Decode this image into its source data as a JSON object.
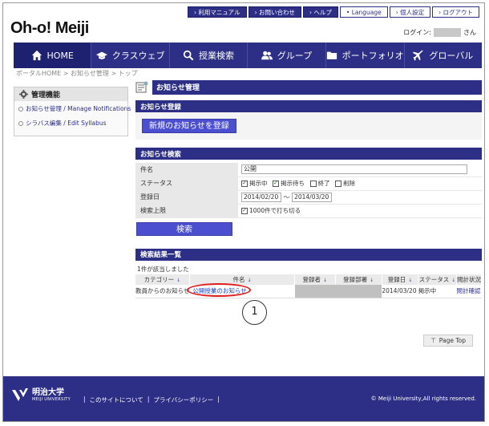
{
  "header": {
    "logo": "Oh-o! Meiji",
    "util_links": [
      {
        "label": "› 利用マニュアル"
      },
      {
        "label": "› お問い合わせ"
      },
      {
        "label": "› ヘルプ"
      },
      {
        "label": "• Language"
      },
      {
        "label": "› 個人設定"
      },
      {
        "label": "› ログアウト"
      }
    ],
    "login_label": "ログイン:",
    "login_suffix": "さん"
  },
  "nav": [
    {
      "label": "HOME",
      "icon": "home-icon"
    },
    {
      "label": "クラスウェブ",
      "icon": "mortarboard-icon"
    },
    {
      "label": "授業検索",
      "icon": "search-icon"
    },
    {
      "label": "グループ",
      "icon": "people-icon"
    },
    {
      "label": "ポートフォリオ",
      "icon": "folder-icon"
    },
    {
      "label": "グローバル",
      "icon": "airplane-icon"
    }
  ],
  "breadcrumb": "ポータルHOME > お知らせ管理 > トップ",
  "sidebar": {
    "title": "管理機能",
    "items": [
      {
        "label": "お知らせ管理 / Manage Notifications"
      },
      {
        "label": "シラバス編集 / Edit Syllabus"
      }
    ]
  },
  "main": {
    "page_title": "お知らせ管理",
    "register": {
      "heading": "お知らせ登録",
      "button": "新規のお知らせを登録"
    },
    "search": {
      "heading": "お知らせ検索",
      "name_label": "件名",
      "name_value": "公開",
      "status_label": "ステータス",
      "status_options": [
        {
          "label": "掲示中",
          "checked": true
        },
        {
          "label": "掲示待ち",
          "checked": true
        },
        {
          "label": "終了",
          "checked": false
        },
        {
          "label": "削除",
          "checked": false
        }
      ],
      "date_label": "登録日",
      "date_from": "2014/02/20",
      "date_sep": "～",
      "date_to": "2014/03/20",
      "limit_label": "検索上限",
      "limit_option": "1000件で打ち切る",
      "button": "検索"
    },
    "results": {
      "heading": "検索結果一覧",
      "count_text": "1件が該当しました",
      "columns": [
        "カテゴリー",
        "件名",
        "登録者",
        "登録部署",
        "登録日",
        "ステータス",
        "閲計状況"
      ],
      "rows": [
        {
          "category": "教員からのお知らせ",
          "subject": "公開授業のお知らせ",
          "date": "2014/03/20",
          "status": "掲示中",
          "view": "閲計確認"
        }
      ]
    },
    "callout_number": "1",
    "page_top": "Page Top"
  },
  "footer": {
    "brand": "明治大学",
    "brand_sub": "MEIJI UNIVERSITY",
    "links": [
      "|",
      "このサイトについて",
      "|",
      "プライバシーポリシー",
      "|"
    ],
    "copyright": "© Meiji University,All rights reserved."
  },
  "colors": {
    "brand_navy": "#2c2f85",
    "button_blue": "#4b4ecf",
    "annotation_red": "#e01e1e"
  }
}
